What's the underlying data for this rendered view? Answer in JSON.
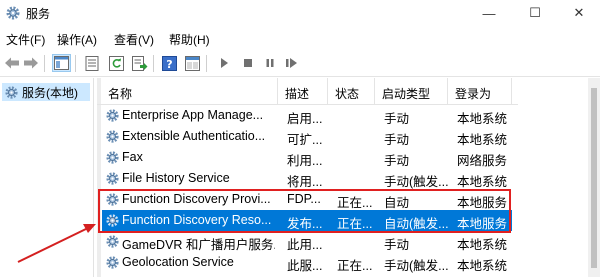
{
  "window": {
    "title": "服务",
    "icon": "gear-services-icon",
    "controls": {
      "minimize": "—",
      "maximize": "☐",
      "close": "✕"
    }
  },
  "menu": {
    "items": [
      {
        "label": "文件(F)"
      },
      {
        "label": "操作(A)"
      },
      {
        "label": "查看(V)"
      },
      {
        "label": "帮助(H)"
      }
    ]
  },
  "toolbar": {
    "icons": [
      "back-arrow-icon",
      "forward-arrow-icon",
      "console-tree-icon",
      "properties-icon",
      "refresh-icon",
      "export-list-icon",
      "help-icon",
      "console-view-icon",
      "start-service-icon",
      "stop-service-icon",
      "pause-service-icon",
      "restart-service-icon"
    ]
  },
  "tree": {
    "root_label": "服务(本地)"
  },
  "table": {
    "columns": [
      "名称",
      "描述",
      "状态",
      "启动类型",
      "登录为"
    ],
    "rows": [
      {
        "name": "Enterprise App Manage...",
        "desc": "启用...",
        "status": "",
        "startup": "手动",
        "logon": "本地系统",
        "selected": false
      },
      {
        "name": "Extensible Authenticatio...",
        "desc": "可扩...",
        "status": "",
        "startup": "手动",
        "logon": "本地系统",
        "selected": false
      },
      {
        "name": "Fax",
        "desc": "利用...",
        "status": "",
        "startup": "手动",
        "logon": "网络服务",
        "selected": false
      },
      {
        "name": "File History Service",
        "desc": "将用...",
        "status": "",
        "startup": "手动(触发...",
        "logon": "本地系统",
        "selected": false
      },
      {
        "name": "Function Discovery Provi...",
        "desc": "FDP...",
        "status": "正在...",
        "startup": "自动",
        "logon": "本地服务",
        "selected": false
      },
      {
        "name": "Function Discovery Reso...",
        "desc": "发布...",
        "status": "正在...",
        "startup": "自动(触发...",
        "logon": "本地服务",
        "selected": true
      },
      {
        "name": "GameDVR 和广播用户服务...",
        "desc": "此用...",
        "status": "",
        "startup": "手动",
        "logon": "本地系统",
        "selected": false
      },
      {
        "name": "Geolocation Service",
        "desc": "此服...",
        "status": "正在...",
        "startup": "手动(触发...",
        "logon": "本地系统",
        "selected": false
      }
    ]
  },
  "colors": {
    "selection": "#0078d7",
    "highlight_box": "#e02020",
    "annotation_arrow": "#d42020"
  }
}
